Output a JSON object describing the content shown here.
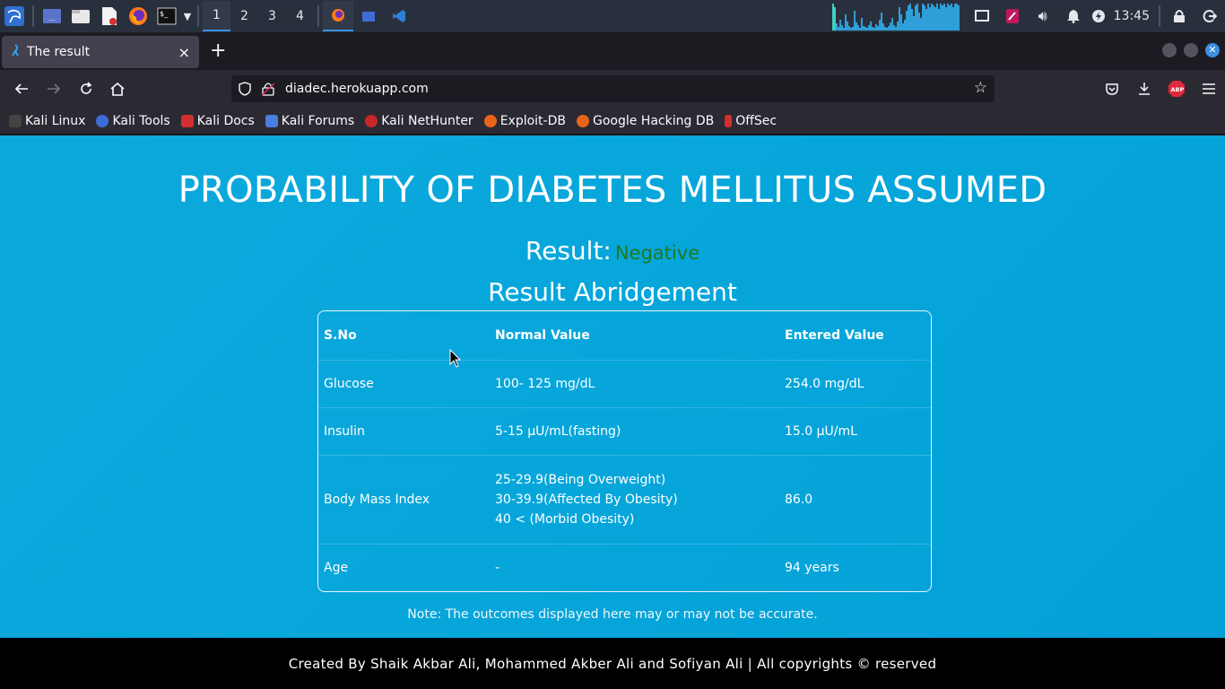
{
  "taskbar": {
    "workspaces": [
      "1",
      "2",
      "3",
      "4"
    ],
    "clock": "13:45"
  },
  "browser": {
    "tab_title": "The result",
    "tab_close": "×",
    "new_tab": "+",
    "url": "diadec.herokuapp.com",
    "bookmarks": [
      "Kali Linux",
      "Kali Tools",
      "Kali Docs",
      "Kali Forums",
      "Kali NetHunter",
      "Exploit-DB",
      "Google Hacking DB",
      "OffSec"
    ]
  },
  "page": {
    "heading": "PROBABILITY OF DIABETES MELLITUS ASSUMED",
    "result_label": "Result:",
    "result_value": "Negative",
    "result_value_color": "#1f7a21",
    "abridgement_title": "Result Abridgement",
    "table": {
      "headers": [
        "S.No",
        "Normal Value",
        "Entered Value"
      ],
      "rows": [
        {
          "name": "Glucose",
          "normal": [
            "100- 125 mg/dL"
          ],
          "entered": "254.0 mg/dL"
        },
        {
          "name": "Insulin",
          "normal": [
            "5-15 µU/mL(fasting)"
          ],
          "entered": "15.0 µU/mL"
        },
        {
          "name": "Body Mass Index",
          "normal": [
            "25-29.9(Being Overweight)",
            "30-39.9(Affected By Obesity)",
            "40 < (Morbid Obesity)"
          ],
          "entered": "86.0"
        },
        {
          "name": "Age",
          "normal": [
            "-"
          ],
          "entered": "94 years"
        }
      ]
    },
    "note": "Note: The outcomes displayed here may or may not be accurate.",
    "footer": "Created By Shaik Akbar Ali, Mohammed Akber Ali and Sofiyan Ali | All copyrights © reserved",
    "background_color": "#06a6db"
  }
}
